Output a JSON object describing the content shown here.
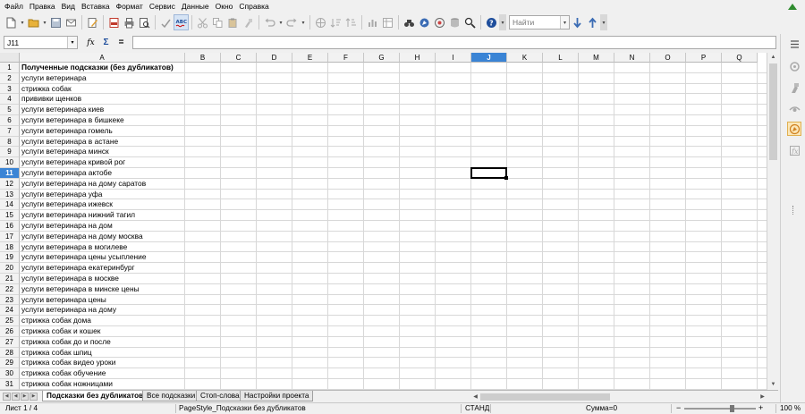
{
  "menu": [
    {
      "label": "Файл",
      "key": "Ф",
      "rest": "айл"
    },
    {
      "label": "Правка",
      "key": "П",
      "rest": "равка"
    },
    {
      "label": "Вид",
      "key": "В",
      "rest": "ид"
    },
    {
      "label": "Вставка",
      "key": "",
      "rest": "Вставка"
    },
    {
      "label": "Формат",
      "key": "",
      "rest": "Формат"
    },
    {
      "label": "Сервис",
      "key": "",
      "rest": "Сервис"
    },
    {
      "label": "Данные",
      "key": "",
      "rest": "Данные"
    },
    {
      "label": "Окно",
      "key": "",
      "rest": "Окно"
    },
    {
      "label": "Справка",
      "key": "С",
      "rest": "правка"
    }
  ],
  "toolbar": {
    "find_placeholder": "Найти"
  },
  "formula_bar": {
    "cell_reference": "J11",
    "function_wizard": "fx",
    "sum": "Σ",
    "equals": "=",
    "content": ""
  },
  "columns": [
    "A",
    "B",
    "C",
    "D",
    "E",
    "F",
    "G",
    "H",
    "I",
    "J",
    "K",
    "L",
    "M",
    "N",
    "O",
    "P",
    "Q"
  ],
  "selected_column": "J",
  "selected_row": 11,
  "rows": [
    {
      "n": "1",
      "a": "Полученные подсказки (без дубликатов)",
      "bold": true
    },
    {
      "n": "2",
      "a": "услуги ветеринара"
    },
    {
      "n": "3",
      "a": "стрижка собак"
    },
    {
      "n": "4",
      "a": "прививки щенков"
    },
    {
      "n": "5",
      "a": "услуги ветеринара киев"
    },
    {
      "n": "6",
      "a": "услуги ветеринара в бишкеке"
    },
    {
      "n": "7",
      "a": "услуги ветеринара гомель"
    },
    {
      "n": "8",
      "a": "услуги ветеринара в астане"
    },
    {
      "n": "9",
      "a": "услуги ветеринара минск"
    },
    {
      "n": "10",
      "a": "услуги ветеринара кривой рог"
    },
    {
      "n": "11",
      "a": "услуги ветеринара актобе"
    },
    {
      "n": "12",
      "a": "услуги ветеринара на дому саратов"
    },
    {
      "n": "13",
      "a": "услуги ветеринара уфа"
    },
    {
      "n": "14",
      "a": "услуги ветеринара ижевск"
    },
    {
      "n": "15",
      "a": "услуги ветеринара нижний тагил"
    },
    {
      "n": "16",
      "a": "услуги ветеринара на дом"
    },
    {
      "n": "17",
      "a": "услуги ветеринара на дому москва"
    },
    {
      "n": "18",
      "a": "услуги ветеринара в могилеве"
    },
    {
      "n": "19",
      "a": "услуги ветеринара цены усыпление"
    },
    {
      "n": "20",
      "a": "услуги ветеринара екатеринбург"
    },
    {
      "n": "21",
      "a": "услуги ветеринара в москве"
    },
    {
      "n": "22",
      "a": "услуги ветеринара в минске цены"
    },
    {
      "n": "23",
      "a": "услуги ветеринара цены"
    },
    {
      "n": "24",
      "a": "услуги ветеринара на дому"
    },
    {
      "n": "25",
      "a": "стрижка собак дома"
    },
    {
      "n": "26",
      "a": "стрижка собак и кошек"
    },
    {
      "n": "27",
      "a": "стрижка собак до и после"
    },
    {
      "n": "28",
      "a": "стрижка собак шпиц"
    },
    {
      "n": "29",
      "a": "стрижка собак видео уроки"
    },
    {
      "n": "30",
      "a": "стрижка собак обучение"
    },
    {
      "n": "31",
      "a": "стрижка собак ножницами"
    }
  ],
  "sheet_tabs": [
    {
      "label": "Подсказки без дубликатов",
      "active": true
    },
    {
      "label": "Все подсказки",
      "active": false
    },
    {
      "label": "Стоп-слова",
      "active": false
    },
    {
      "label": "Настройки проекта",
      "active": false
    }
  ],
  "status": {
    "sheet": "Лист 1 / 4",
    "page_style": "PageStyle_Подсказки без дубликатов",
    "mode": "СТАНД",
    "sum": "Сумма=0",
    "zoom": "100 %",
    "zoom_minus": "−",
    "zoom_plus": "+"
  },
  "colors": {
    "selection": "#3a84d5",
    "grid_line": "#d8d8d8",
    "header_bg": "#f2f2f2",
    "chrome_bg": "#f0f0f0"
  }
}
